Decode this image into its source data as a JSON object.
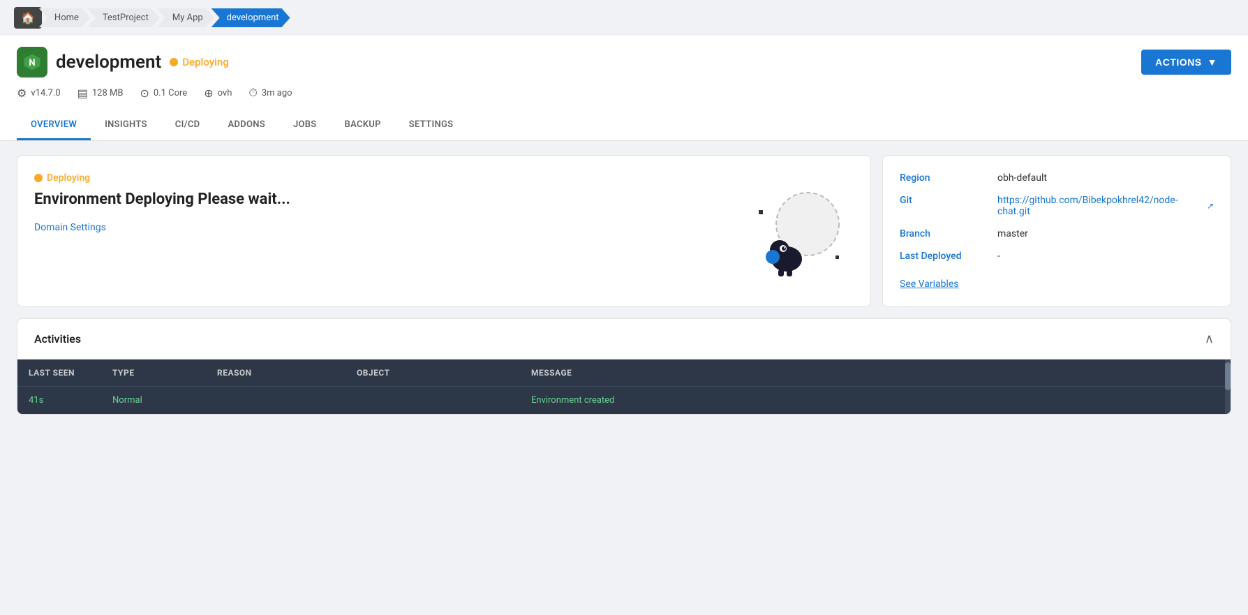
{
  "breadcrumb": {
    "home_icon": "🏠",
    "items": [
      {
        "label": "Home",
        "active": false
      },
      {
        "label": "TestProject",
        "active": false
      },
      {
        "label": "My App",
        "active": false
      },
      {
        "label": "development",
        "active": true
      }
    ]
  },
  "header": {
    "logo_icon": "⬡",
    "app_name": "development",
    "status": "Deploying",
    "actions_label": "ACTIONS",
    "meta": [
      {
        "icon": "⚙",
        "value": "v14.7.0"
      },
      {
        "icon": "▤",
        "value": "128 MB"
      },
      {
        "icon": "⊙",
        "value": "0.1 Core"
      },
      {
        "icon": "⊕",
        "value": "ovh"
      },
      {
        "icon": "⏱",
        "value": "3m ago"
      }
    ]
  },
  "tabs": [
    {
      "label": "OVERVIEW",
      "active": true
    },
    {
      "label": "INSIGHTS",
      "active": false
    },
    {
      "label": "CI/CD",
      "active": false
    },
    {
      "label": "ADDONS",
      "active": false
    },
    {
      "label": "JOBS",
      "active": false
    },
    {
      "label": "BACKUP",
      "active": false
    },
    {
      "label": "SETTINGS",
      "active": false
    }
  ],
  "deploy_card": {
    "status_label": "Deploying",
    "title": "Environment Deploying Please wait...",
    "domain_link": "Domain Settings"
  },
  "info_card": {
    "rows": [
      {
        "label": "Region",
        "value": "obh-default",
        "is_link": false
      },
      {
        "label": "Git",
        "value": "https://github.com/Bibekpokhrel42/node-chat.git",
        "is_link": true
      },
      {
        "label": "Branch",
        "value": "master",
        "is_link": false
      },
      {
        "label": "Last Deployed",
        "value": "-",
        "is_link": false
      }
    ],
    "see_variables": "See Variables"
  },
  "activities": {
    "title": "Activities",
    "table": {
      "headers": [
        "LAST SEEN",
        "TYPE",
        "REASON",
        "OBJECT",
        "MESSAGE"
      ],
      "rows": [
        {
          "last_seen": "41s",
          "type": "Normal",
          "reason": "",
          "object": "",
          "message": "Environment created"
        }
      ]
    }
  }
}
